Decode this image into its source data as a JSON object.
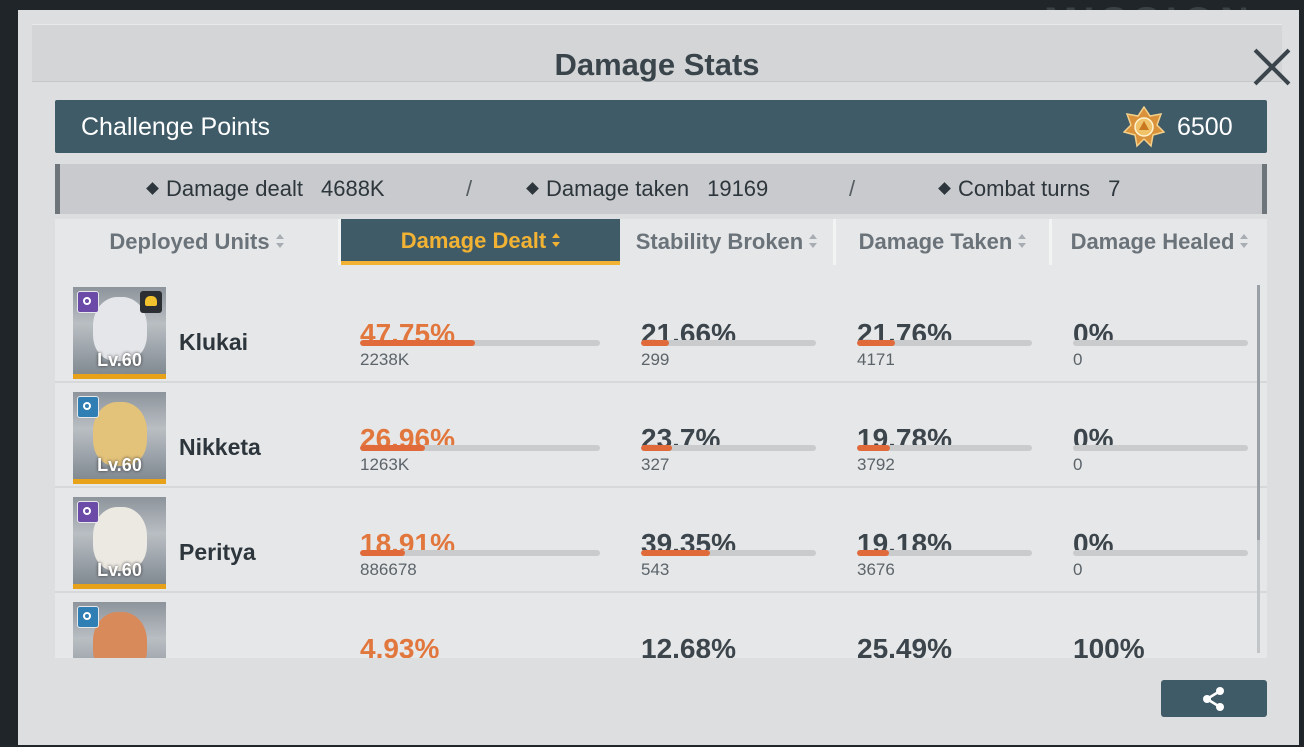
{
  "title": "Damage Stats",
  "challenge": {
    "label": "Challenge Points",
    "value": "6500"
  },
  "summary": {
    "damage_dealt": {
      "label": "Damage dealt",
      "value": "4688K"
    },
    "damage_taken": {
      "label": "Damage taken",
      "value": "19169"
    },
    "combat_turns": {
      "label": "Combat turns",
      "value": "7"
    },
    "separator": "/"
  },
  "tabs": [
    {
      "label": "Deployed Units",
      "active": false
    },
    {
      "label": "Damage Dealt",
      "active": true
    },
    {
      "label": "Stability Broken",
      "active": false
    },
    {
      "label": "Damage Taken",
      "active": false
    },
    {
      "label": "Damage Healed",
      "active": false
    }
  ],
  "units": [
    {
      "name": "Klukai",
      "level": "Lv.60",
      "class_color": "#6b4aa8",
      "icon": "purple-class-icon",
      "squad_badge": true,
      "dealt": {
        "pct": "47.75%",
        "value": "2238K",
        "fill": 0.4775
      },
      "stability": {
        "pct": "21.66%",
        "value": "299",
        "fill": 0.1575
      },
      "taken": {
        "pct": "21.76%",
        "value": "4171",
        "fill": 0.2176
      },
      "healed": {
        "pct": "0%",
        "value": "0",
        "fill": 0
      }
    },
    {
      "name": "Nikketa",
      "level": "Lv.60",
      "class_color": "#2f7fb5",
      "icon": "blue-class-icon",
      "squad_badge": false,
      "dealt": {
        "pct": "26.96%",
        "value": "1263K",
        "fill": 0.2696
      },
      "stability": {
        "pct": "23.7%",
        "value": "327",
        "fill": 0.175
      },
      "taken": {
        "pct": "19.78%",
        "value": "3792",
        "fill": 0.19
      },
      "healed": {
        "pct": "0%",
        "value": "0",
        "fill": 0
      }
    },
    {
      "name": "Peritya",
      "level": "Lv.60",
      "class_color": "#6b4aa8",
      "icon": "purple-class-icon",
      "squad_badge": false,
      "dealt": {
        "pct": "18.91%",
        "value": "886678",
        "fill": 0.1891
      },
      "stability": {
        "pct": "39.35%",
        "value": "543",
        "fill": 0.3935
      },
      "taken": {
        "pct": "19.18%",
        "value": "3676",
        "fill": 0.18
      },
      "healed": {
        "pct": "0%",
        "value": "0",
        "fill": 0
      }
    },
    {
      "name": "",
      "level": "",
      "class_color": "#2f7fb5",
      "icon": "blue-class-icon",
      "squad_badge": false,
      "dealt": {
        "pct": "4.93%",
        "value": "",
        "fill": 0.0493
      },
      "stability": {
        "pct": "12.68%",
        "value": "",
        "fill": 0.1268
      },
      "taken": {
        "pct": "25.49%",
        "value": "",
        "fill": 0.2549
      },
      "healed": {
        "pct": "100%",
        "value": "",
        "fill": 1
      }
    }
  ],
  "colors": {
    "accent": "#f2b233",
    "header": "#3f5b68",
    "bar_fill": "#e06a3a",
    "pct_orange": "#e2773e"
  }
}
